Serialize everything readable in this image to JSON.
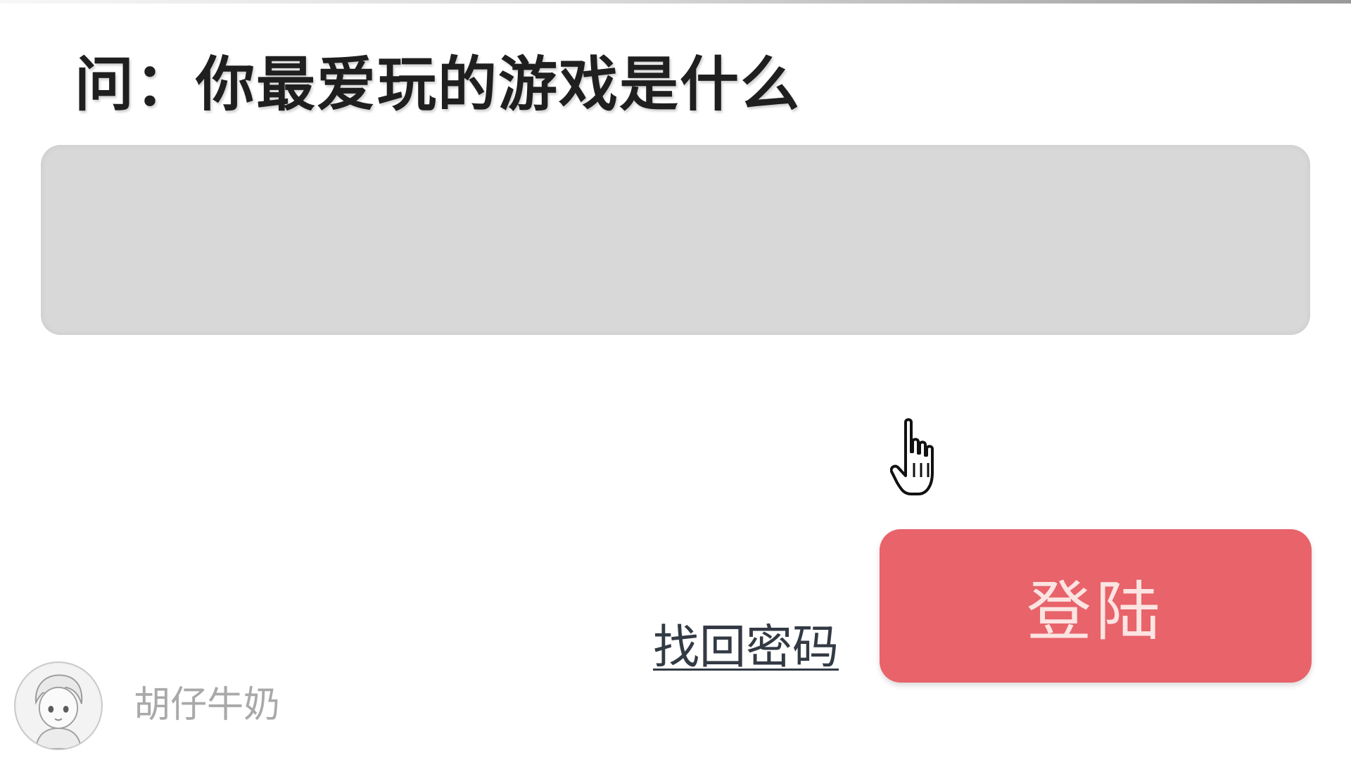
{
  "question": {
    "text": "问：你最爱玩的游戏是什么"
  },
  "answer_input": {
    "value": "",
    "placeholder": ""
  },
  "actions": {
    "forgot_password_label": "找回密码",
    "login_label": "登陆"
  },
  "watermark": {
    "username": "胡仔牛奶",
    "avatar_icon": "avatar-icon"
  },
  "cursor_icon": "hand-pointer-icon",
  "colors": {
    "input_background": "#d7d8d7",
    "login_button": "#e8636a",
    "login_text": "#fbe4e2",
    "question_text": "#1f1f1f",
    "link_text": "#333a44"
  }
}
